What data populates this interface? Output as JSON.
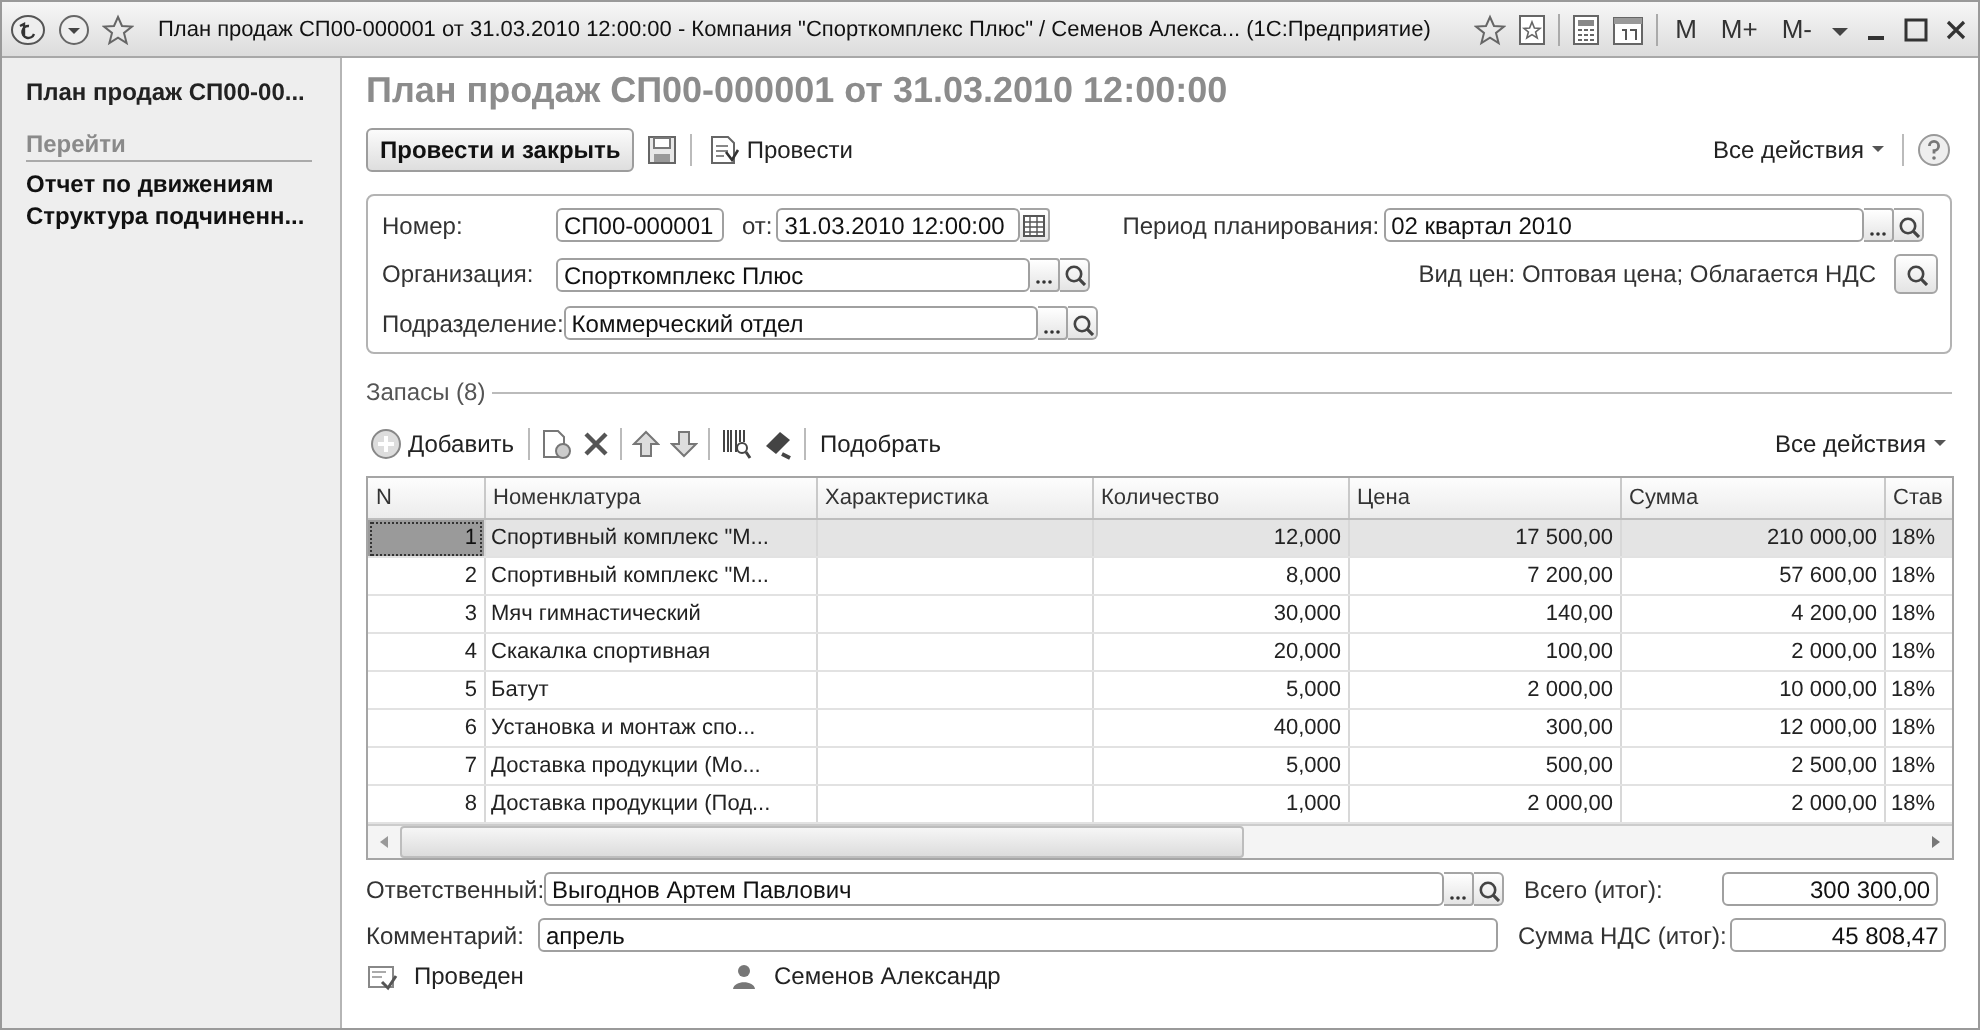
{
  "window": {
    "title": "План продаж СП00-000001 от 31.03.2010 12:00:00 - Компания \"Спорткомплекс Плюс\" / Семенов Алекса... (1С:Предприятие)",
    "memory_buttons": [
      "M",
      "M+",
      "M-"
    ]
  },
  "sidebar": {
    "title": "План продаж СП00-00...",
    "section": "Перейти",
    "items": [
      {
        "label": "Отчет по движениям"
      },
      {
        "label": "Структура подчиненн..."
      }
    ]
  },
  "document": {
    "heading": "План продаж СП00-000001 от 31.03.2010 12:00:00",
    "post_close": "Провести и закрыть",
    "post": "Провести",
    "all_actions": "Все действия",
    "number_label": "Номер:",
    "number": "СП00-000001",
    "date_label": "от:",
    "date": "31.03.2010 12:00:00",
    "period_label": "Период планирования:",
    "period": "02 квартал 2010",
    "org_label": "Организация:",
    "org": "Спорткомплекс Плюс",
    "prices": "Вид цен: Оптовая цена; Облагается НДС",
    "dept_label": "Подразделение:",
    "dept": "Коммерческий отдел"
  },
  "table": {
    "title": "Запасы (8)",
    "add": "Добавить",
    "pick": "Подобрать",
    "all_actions": "Все действия",
    "columns": [
      "N",
      "Номенклатура",
      "Характеристика",
      "Количество",
      "Цена",
      "Сумма",
      "Став"
    ],
    "rows": [
      {
        "selected": true,
        "cells": [
          "1",
          "Спортивный комплекс \"М...",
          "",
          "12,000",
          "17 500,00",
          "210 000,00",
          "18%"
        ]
      },
      {
        "selected": false,
        "cells": [
          "2",
          "Спортивный комплекс \"М...",
          "",
          "8,000",
          "7 200,00",
          "57 600,00",
          "18%"
        ]
      },
      {
        "selected": false,
        "cells": [
          "3",
          "Мяч гимнастический",
          "",
          "30,000",
          "140,00",
          "4 200,00",
          "18%"
        ]
      },
      {
        "selected": false,
        "cells": [
          "4",
          "Скакалка спортивная",
          "",
          "20,000",
          "100,00",
          "2 000,00",
          "18%"
        ]
      },
      {
        "selected": false,
        "cells": [
          "5",
          "Батут",
          "",
          "5,000",
          "2 000,00",
          "10 000,00",
          "18%"
        ]
      },
      {
        "selected": false,
        "cells": [
          "6",
          "Установка и монтаж спо...",
          "",
          "40,000",
          "300,00",
          "12 000,00",
          "18%"
        ]
      },
      {
        "selected": false,
        "cells": [
          "7",
          "Доставка продукции (Мо...",
          "",
          "5,000",
          "500,00",
          "2 500,00",
          "18%"
        ]
      },
      {
        "selected": false,
        "cells": [
          "8",
          "Доставка продукции (Под...",
          "",
          "1,000",
          "2 000,00",
          "2 000,00",
          "18%"
        ]
      }
    ]
  },
  "footer": {
    "responsible_label": "Ответственный:",
    "responsible": "Выгоднов Артем Павлович",
    "total_label": "Всего (итог):",
    "total": "300 300,00",
    "comment_label": "Комментарий:",
    "comment": "апрель",
    "vat_label": "Сумма НДС (итог):",
    "vat": "45 808,47",
    "status": "Проведен",
    "author": "Семенов Александр"
  }
}
